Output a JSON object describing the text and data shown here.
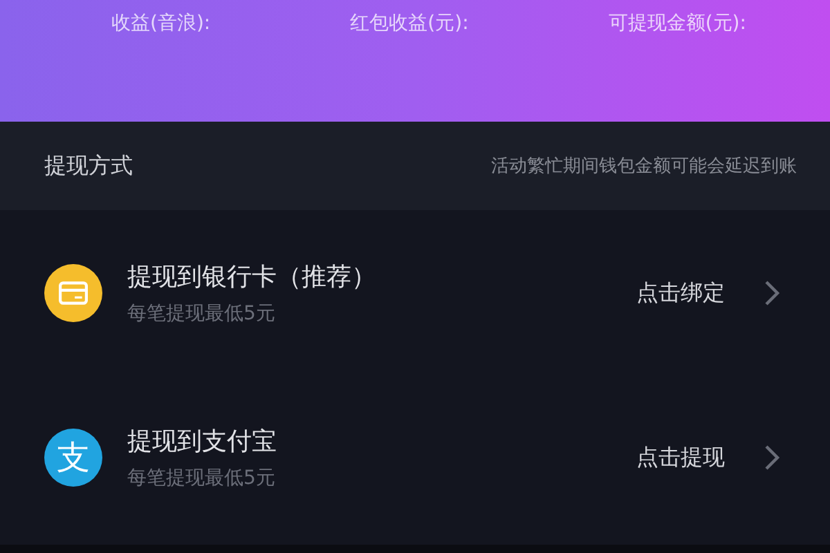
{
  "summary": {
    "labels": [
      "收益(音浪):",
      "红包收益(元):",
      "可提现金额(元):"
    ]
  },
  "section": {
    "title": "提现方式",
    "notice": "活动繁忙期间钱包金额可能会延迟到账"
  },
  "methods": [
    {
      "kind": "bank",
      "title": "提现到银行卡（推荐）",
      "subtitle": "每笔提现最低5元",
      "action": "点击绑定"
    },
    {
      "kind": "alipay",
      "icon_text": "支",
      "title": "提现到支付宝",
      "subtitle": "每笔提现最低5元",
      "action": "点击提现"
    }
  ]
}
